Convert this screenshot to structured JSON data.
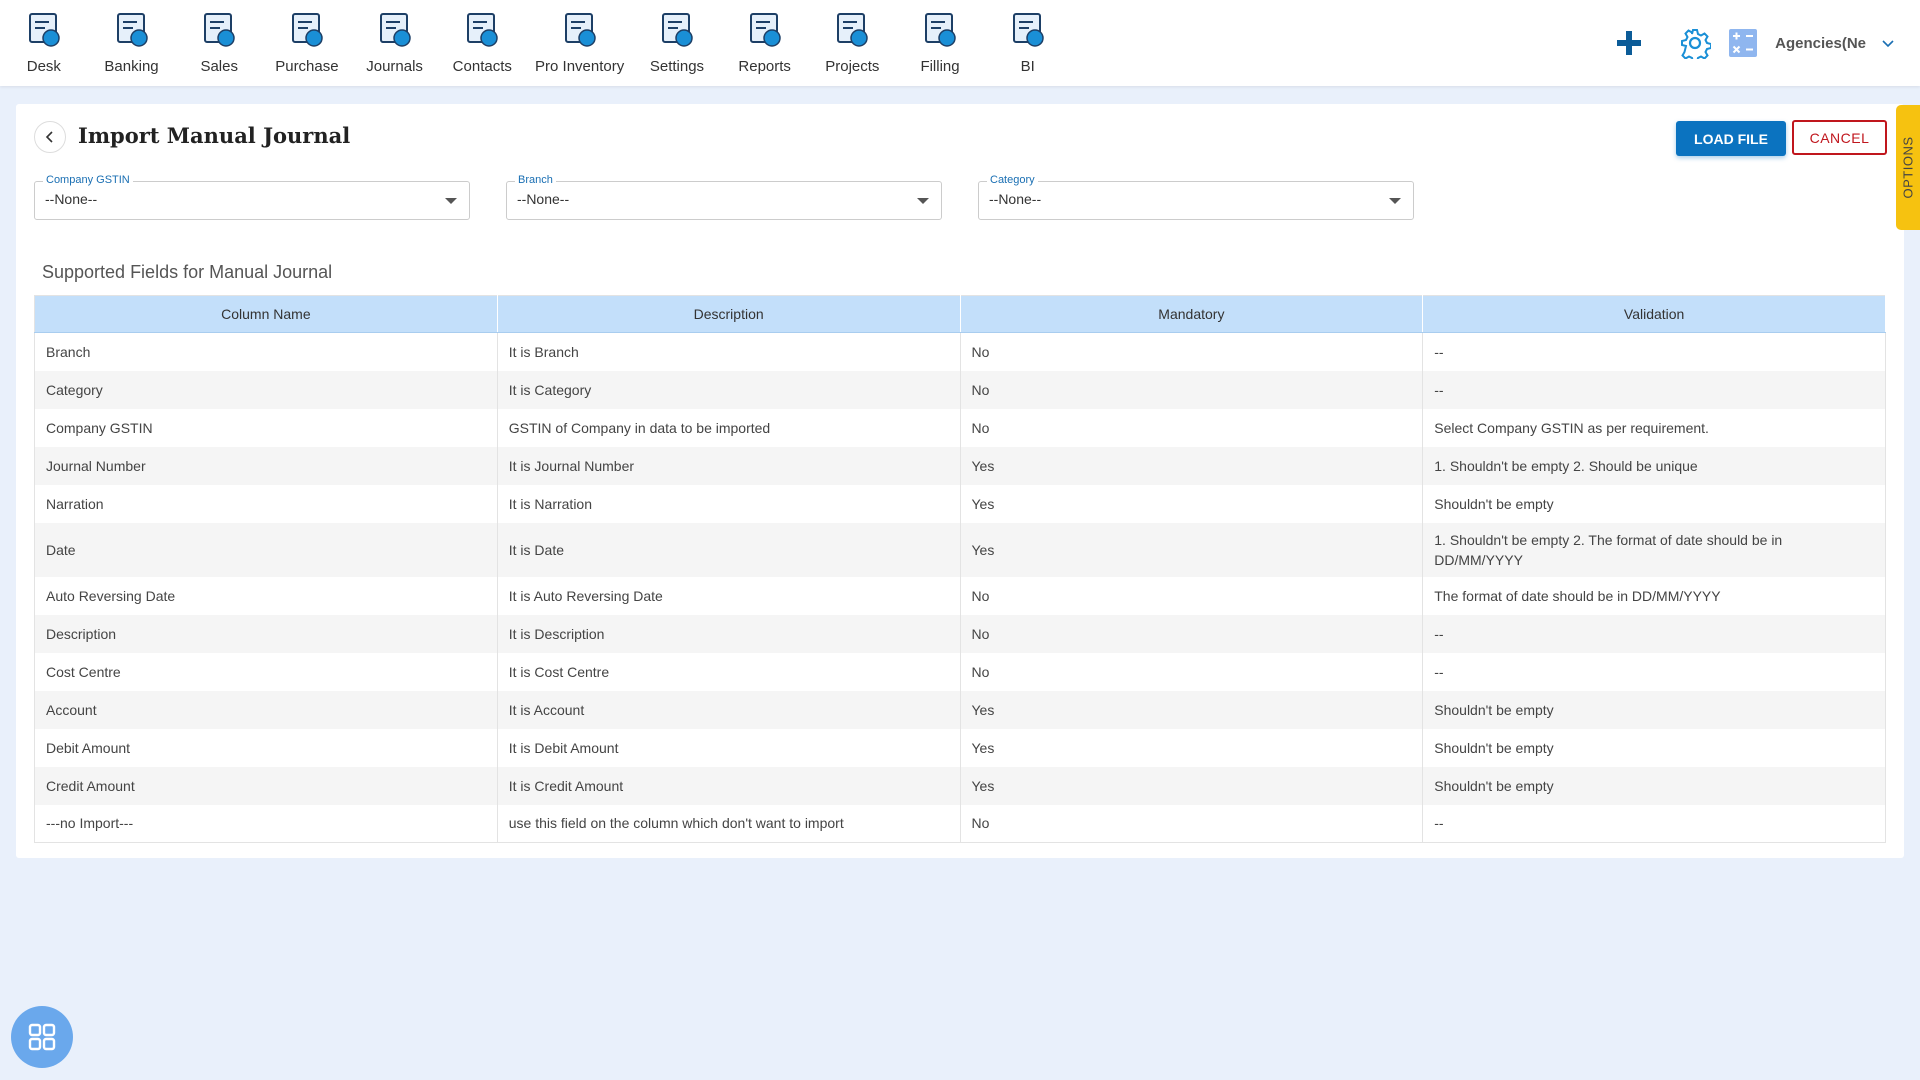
{
  "nav": [
    {
      "label": "Desk",
      "icon": "desk-icon"
    },
    {
      "label": "Banking",
      "icon": "bank-icon"
    },
    {
      "label": "Sales",
      "icon": "sales-icon"
    },
    {
      "label": "Purchase",
      "icon": "purchase-icon"
    },
    {
      "label": "Journals",
      "icon": "journals-icon"
    },
    {
      "label": "Contacts",
      "icon": "contacts-icon"
    },
    {
      "label": "Pro Inventory",
      "icon": "inventory-icon"
    },
    {
      "label": "Settings",
      "icon": "settings-icon"
    },
    {
      "label": "Reports",
      "icon": "reports-icon"
    },
    {
      "label": "Projects",
      "icon": "projects-icon"
    },
    {
      "label": "Filling",
      "icon": "filling-icon"
    },
    {
      "label": "BI",
      "icon": "bi-icon"
    }
  ],
  "header": {
    "agency": "Agencies(Ne"
  },
  "page": {
    "title": "Import Manual Journal",
    "load_file": "LOAD FILE",
    "cancel": "CANCEL",
    "options": "OPTIONS"
  },
  "filters": [
    {
      "label": "Company GSTIN",
      "value": "--None--"
    },
    {
      "label": "Branch",
      "value": "--None--"
    },
    {
      "label": "Category",
      "value": "--None--"
    }
  ],
  "table": {
    "title": "Supported Fields for Manual Journal",
    "columns": [
      "Column Name",
      "Description",
      "Mandatory",
      "Validation"
    ],
    "rows": [
      [
        "Branch",
        "It is Branch",
        "No",
        "--"
      ],
      [
        "Category",
        "It is Category",
        "No",
        "--"
      ],
      [
        "Company GSTIN",
        "GSTIN of Company in data to be imported",
        "No",
        "Select Company GSTIN as per requirement."
      ],
      [
        "Journal Number",
        "It is Journal Number",
        "Yes",
        "1. Shouldn't be empty 2. Should be unique"
      ],
      [
        "Narration",
        "It is Narration",
        "Yes",
        "Shouldn't be empty"
      ],
      [
        "Date",
        "It is Date",
        "Yes",
        "1. Shouldn't be empty 2. The format of date should be in DD/MM/YYYY"
      ],
      [
        "Auto Reversing Date",
        "It is Auto Reversing Date",
        "No",
        "The format of date should be in DD/MM/YYYY"
      ],
      [
        "Description",
        "It is Description",
        "No",
        "--"
      ],
      [
        "Cost Centre",
        "It is Cost Centre",
        "No",
        "--"
      ],
      [
        "Account",
        "It is Account",
        "Yes",
        "Shouldn't be empty"
      ],
      [
        "Debit Amount",
        "It is Debit Amount",
        "Yes",
        "Shouldn't be empty"
      ],
      [
        "Credit Amount",
        "It is Credit Amount",
        "Yes",
        "Shouldn't be empty"
      ],
      [
        "---no Import---",
        "use this field on the column which don't want to import",
        "No",
        "--"
      ]
    ]
  },
  "colors": {
    "primary": "#0b73c0",
    "cancel": "#c0161d",
    "options": "#f6c210",
    "header_row": "#c3dffa"
  }
}
